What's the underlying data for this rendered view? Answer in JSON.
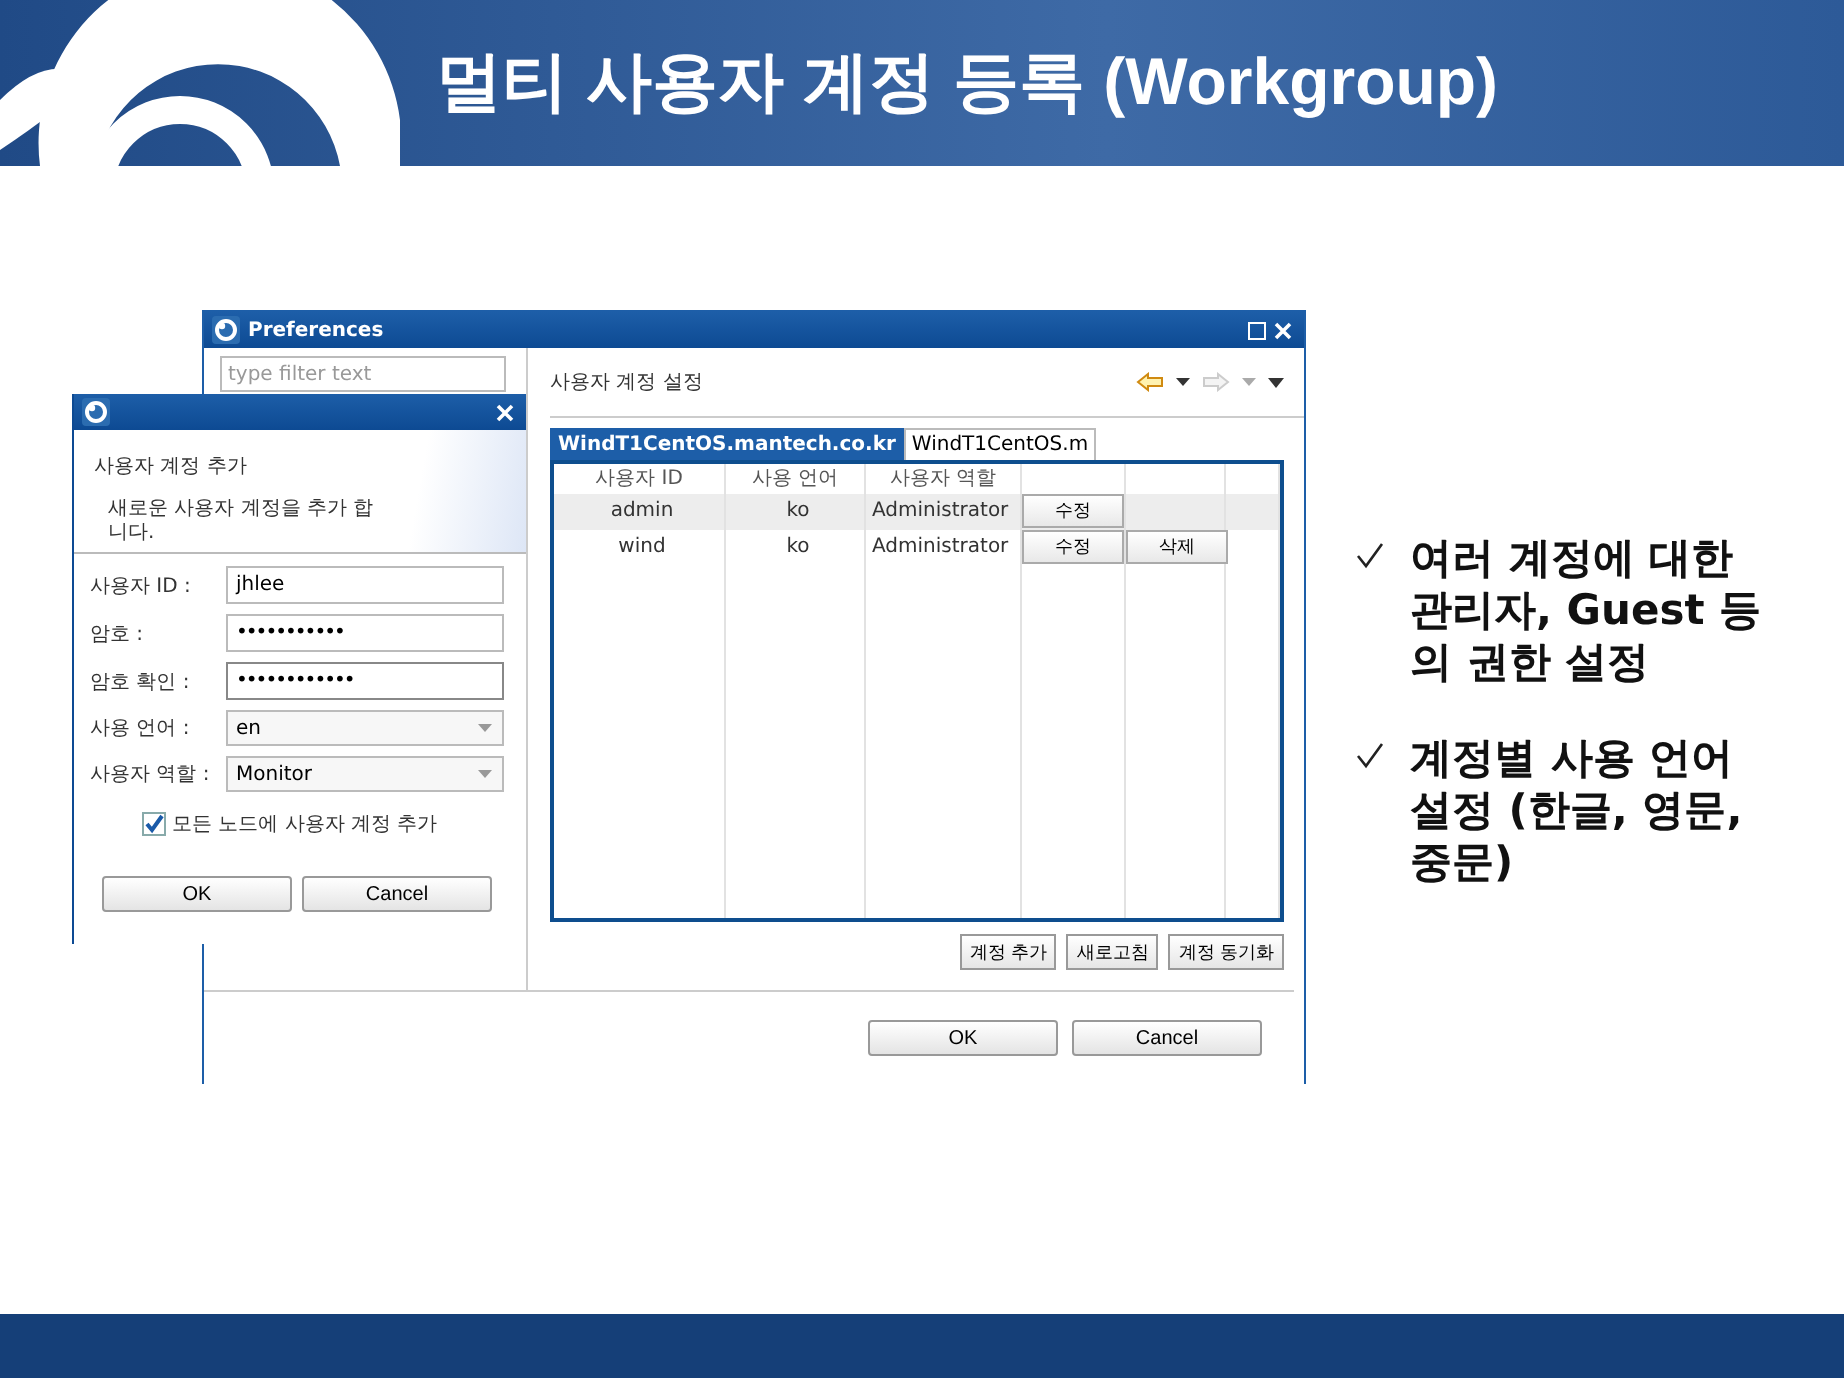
{
  "slide": {
    "title": "멀티 사용자 계정 등록 (Workgroup)",
    "bullets": [
      "여러 계정에 대한 관리자, Guest 등의 권한 설정",
      "계정별 사용 언어 설정 (한글, 영문, 중문)"
    ]
  },
  "preferences": {
    "title": "Preferences",
    "filter": {
      "placeholder": "type filter text"
    },
    "page_title": "사용자 계정 설정",
    "tabs": [
      {
        "label": "WindT1CentOS.mantech.co.kr",
        "selected": true
      },
      {
        "label": "WindT1CentOS.m",
        "selected": false
      }
    ],
    "table": {
      "columns": [
        "사용자 ID",
        "사용 언어",
        "사용자 역할"
      ],
      "rows": [
        {
          "user_id": "admin",
          "language": "ko",
          "role": "Administrator",
          "actions": [
            "수정"
          ]
        },
        {
          "user_id": "wind",
          "language": "ko",
          "role": "Administrator",
          "actions": [
            "수정",
            "삭제"
          ]
        }
      ]
    },
    "table_buttons": [
      "계정 추가",
      "새로고침",
      "계정 동기화"
    ],
    "buttons": [
      "OK",
      "Cancel"
    ]
  },
  "dialog": {
    "heading": "사용자 계정 추가",
    "description": "새로운 사용자 계정을 추가 합니다.",
    "fields": [
      {
        "label": "사용자 ID :",
        "kind": "text",
        "value": "jhlee"
      },
      {
        "label": "암호 :",
        "kind": "password",
        "value": "•••••••••••"
      },
      {
        "label": "암호 확인 :",
        "kind": "password",
        "value": "••••••••••••",
        "focused": true
      },
      {
        "label": "사용 언어 :",
        "kind": "combo",
        "value": "en"
      },
      {
        "label": "사용자 역할 :",
        "kind": "combo",
        "value": "Monitor"
      }
    ],
    "checkbox": {
      "label": "모든 노드에 사용자 계정 추가",
      "checked": true
    },
    "buttons": [
      "OK",
      "Cancel"
    ]
  }
}
